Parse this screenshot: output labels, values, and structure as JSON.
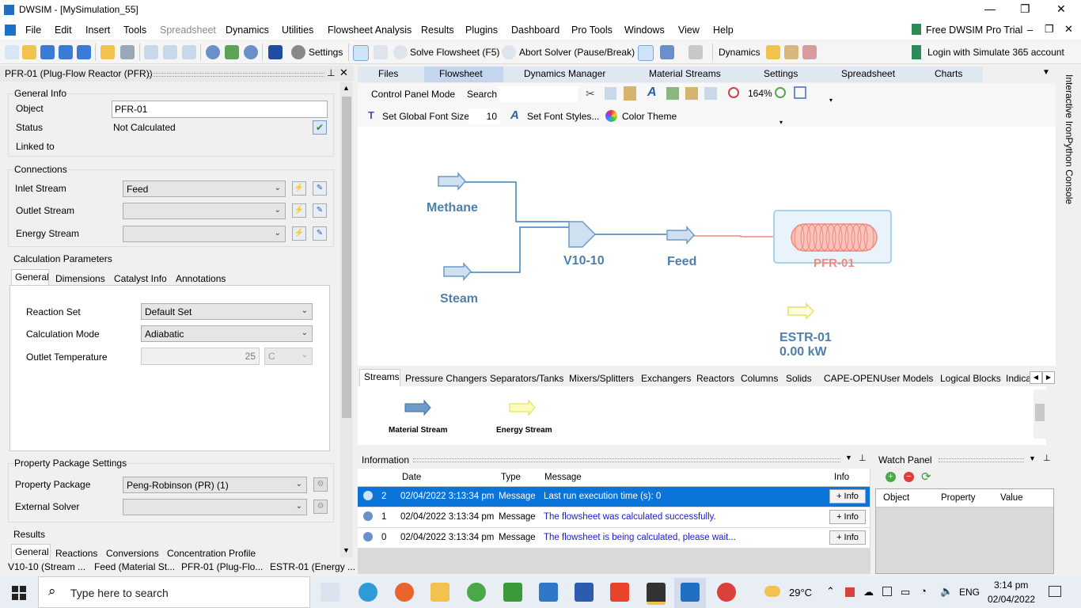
{
  "window": {
    "title": "DWSIM - [MySimulation_55]"
  },
  "menu": [
    "File",
    "Edit",
    "Insert",
    "Tools",
    "Spreadsheet",
    "Dynamics",
    "Utilities",
    "Flowsheet Analysis",
    "Results",
    "Plugins",
    "Dashboard",
    "Pro Tools",
    "Windows",
    "View",
    "Help"
  ],
  "top_right": {
    "trial": "Free DWSIM Pro Trial",
    "login": "Login with Simulate 365 account"
  },
  "toolbar": {
    "settings": "Settings",
    "solve": "Solve Flowsheet (F5)",
    "abort": "Abort Solver (Pause/Break)",
    "dynamics": "Dynamics"
  },
  "left_panel": {
    "title": "PFR-01 (Plug-Flow Reactor (PFR))",
    "general_info": "General Info",
    "object_label": "Object",
    "object_value": "PFR-01",
    "status_label": "Status",
    "status_value": "Not Calculated",
    "linked_label": "Linked to",
    "connections": "Connections",
    "inlet_label": "Inlet Stream",
    "inlet_value": "Feed",
    "outlet_label": "Outlet Stream",
    "energy_label": "Energy Stream",
    "calc_params": "Calculation Parameters",
    "tabs": [
      "General",
      "Dimensions",
      "Catalyst Info",
      "Annotations"
    ],
    "reaction_set_label": "Reaction Set",
    "reaction_set_value": "Default Set",
    "calc_mode_label": "Calculation Mode",
    "calc_mode_value": "Adiabatic",
    "outlet_temp_label": "Outlet Temperature",
    "outlet_temp_value": "25",
    "outlet_temp_unit": "C",
    "pp_settings": "Property Package Settings",
    "pp_label": "Property Package",
    "pp_value": "Peng-Robinson (PR) (1)",
    "ext_solver_label": "External Solver",
    "results": "Results",
    "result_tabs": [
      "General",
      "Reactions",
      "Conversions",
      "Concentration Profile"
    ]
  },
  "status_items": [
    "V10-10 (Stream ...",
    "Feed (Material St...",
    "PFR-01 (Plug-Flo...",
    "ESTR-01 (Energy ..."
  ],
  "doc_tabs": [
    "Files",
    "Flowsheet",
    "Dynamics Manager",
    "Material Streams",
    "Settings",
    "Spreadsheet",
    "Charts"
  ],
  "fs_toolbar": {
    "control_panel": "Control Panel Mode",
    "search": "Search",
    "zoom": "164%",
    "font_size_label": "Set Global Font Size",
    "font_size": "10",
    "font_styles": "Set Font Styles...",
    "color_theme": "Color Theme"
  },
  "flowsheet": {
    "methane": "Methane",
    "steam": "Steam",
    "mixer": "V10-10",
    "feed": "Feed",
    "reactor": "PFR-01",
    "energy": "ESTR-01",
    "energy_value": "0.00 kW"
  },
  "object_tabs": [
    "Streams",
    "Pressure Changers",
    "Separators/Tanks",
    "Mixers/Splitters",
    "Exchangers",
    "Reactors",
    "Columns",
    "Solids",
    "CAPE-OPEN",
    "User Models",
    "Logical Blocks",
    "Indica"
  ],
  "palette": {
    "material": "Material Stream",
    "energy": "Energy Stream"
  },
  "information": {
    "title": "Information",
    "columns": [
      "Date",
      "Type",
      "Message",
      "Info"
    ],
    "rows": [
      {
        "n": "2",
        "date": "02/04/2022 3:13:34 pm",
        "type": "Message",
        "msg": "Last run execution time (s): 0",
        "btn": "+ Info"
      },
      {
        "n": "1",
        "date": "02/04/2022 3:13:34 pm",
        "type": "Message",
        "msg": "The flowsheet was calculated successfully.",
        "btn": "+ Info"
      },
      {
        "n": "0",
        "date": "02/04/2022 3:13:34 pm",
        "type": "Message",
        "msg": "The flowsheet is being calculated, please wait...",
        "btn": "+ Info"
      }
    ]
  },
  "watch": {
    "title": "Watch Panel",
    "columns": [
      "Object",
      "Property",
      "Value"
    ]
  },
  "console_label": "Interactive IronPython Console",
  "taskbar": {
    "search_placeholder": "Type here to search",
    "weather": "29°C",
    "lang": "ENG",
    "time": "3:14 pm",
    "date": "02/04/2022"
  },
  "colors": {
    "stream_blue": "#6b9bc8",
    "label_blue": "#4f7fab",
    "selected_row": "#0a74d9",
    "reactor_red": "#f08a7a"
  }
}
